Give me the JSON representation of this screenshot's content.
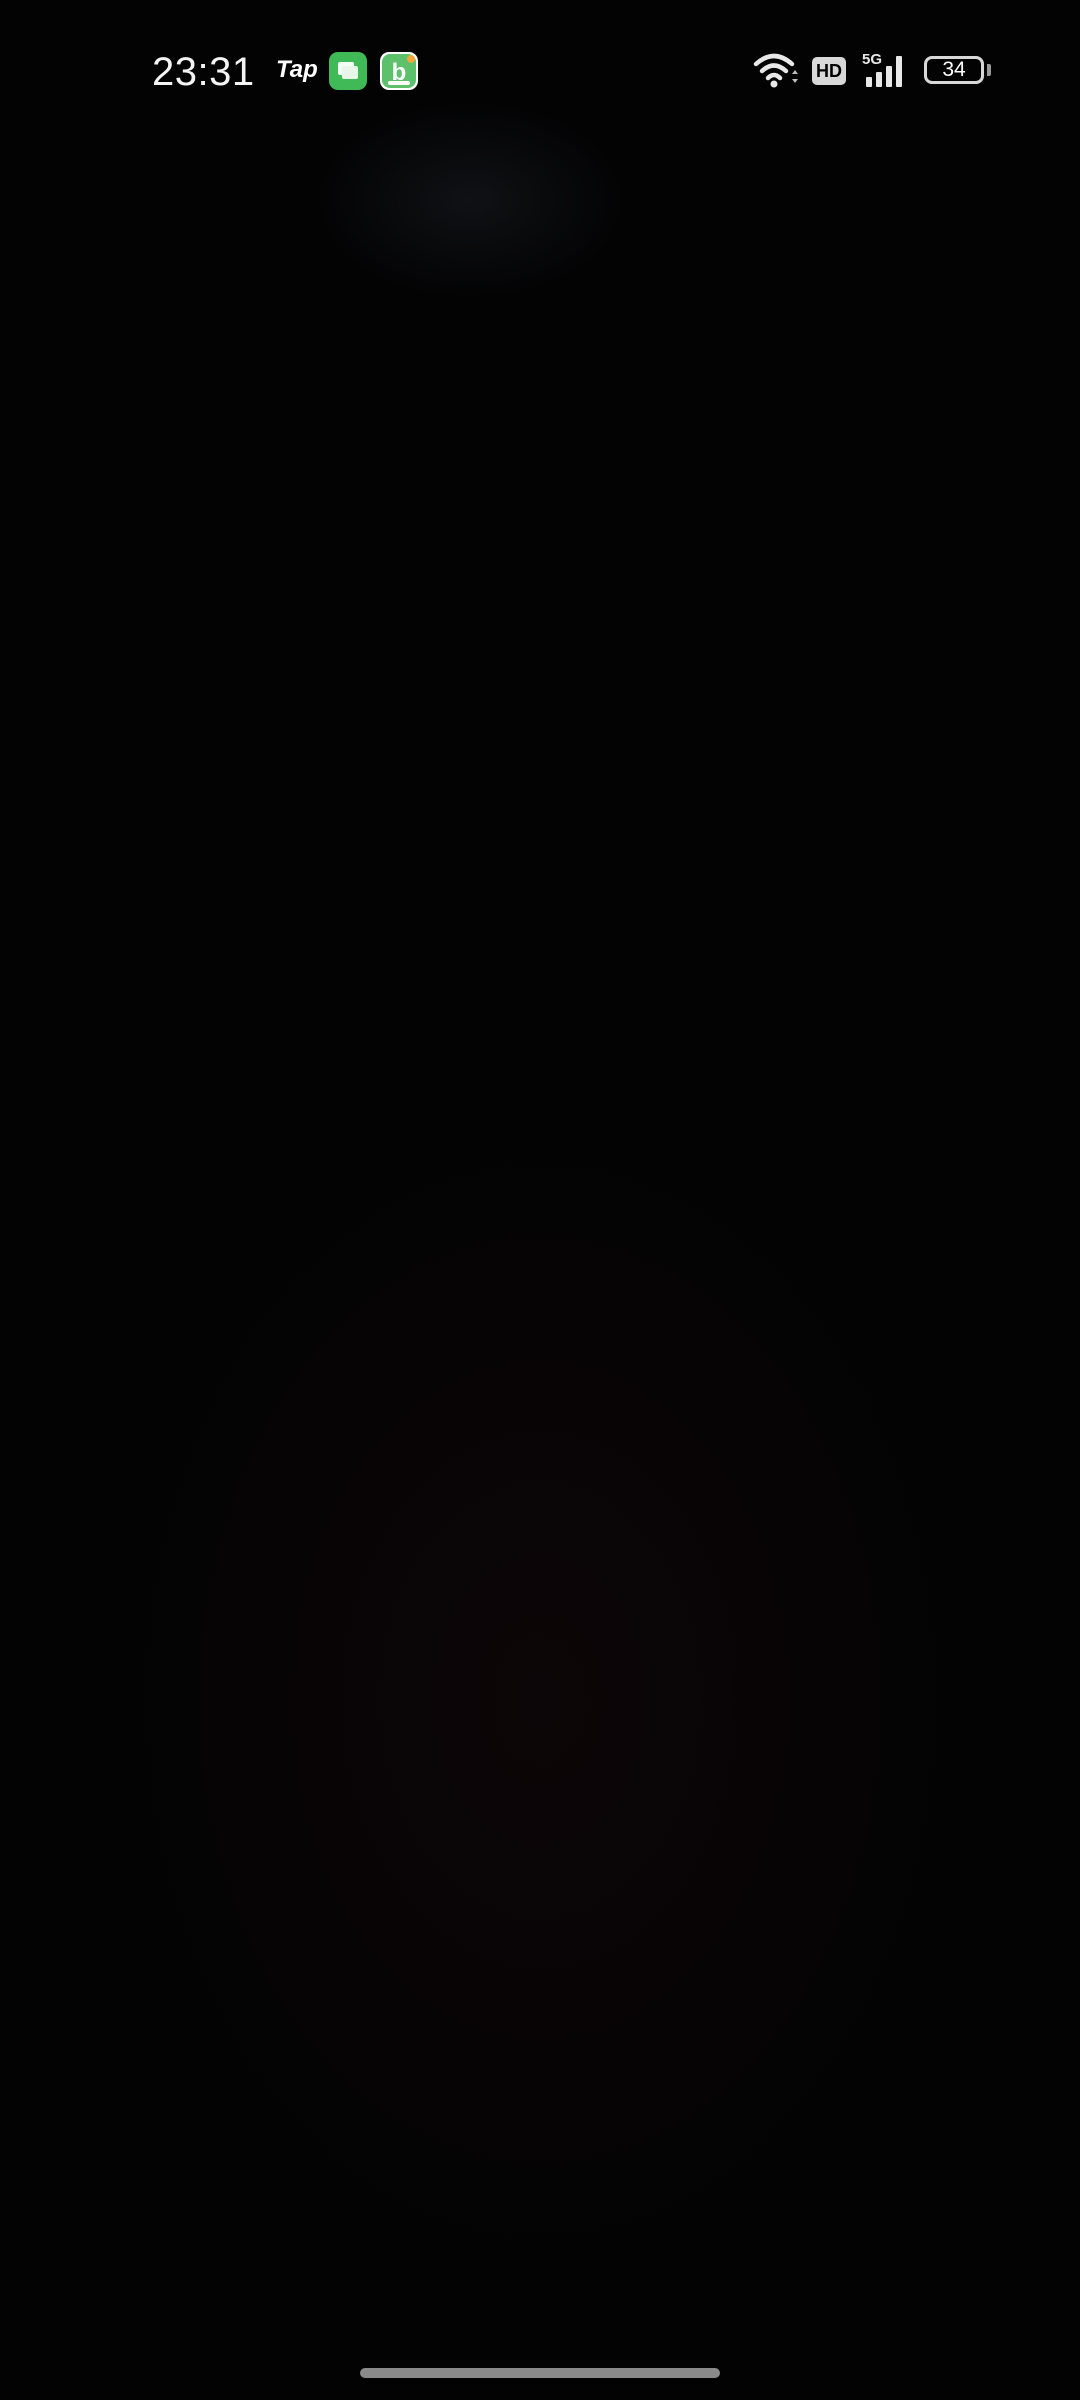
{
  "status_bar": {
    "time": "23:31",
    "notification_icons": [
      {
        "name": "taptap-icon",
        "label": "Tap"
      },
      {
        "name": "messages-app-icon"
      },
      {
        "name": "b-app-icon"
      }
    ],
    "wifi_icon": "wifi-icon",
    "hd_label": "HD",
    "network_label": "5G",
    "battery_level": "34"
  },
  "colors": {
    "background": "#030304",
    "messages_app": "#3fba57",
    "b_app_accent": "#4caf50",
    "status_text": "#ffffff"
  }
}
